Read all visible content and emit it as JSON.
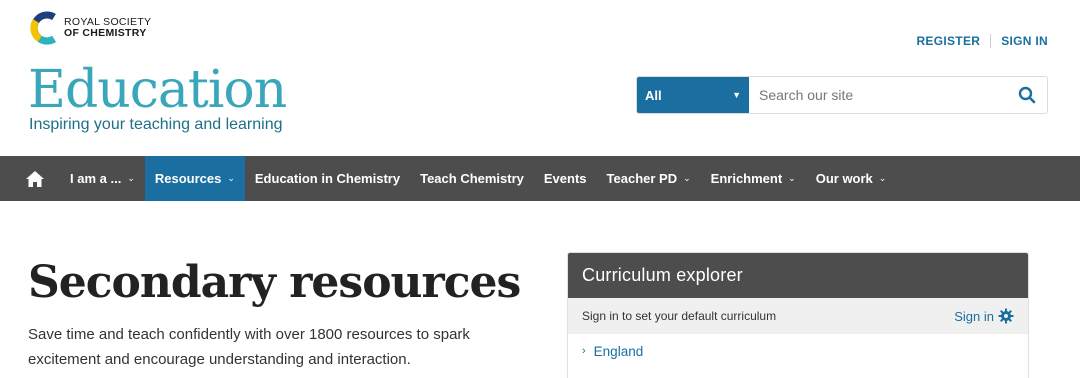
{
  "header": {
    "logo": {
      "line1": "ROYAL SOCIETY",
      "line2": "OF CHEMISTRY"
    },
    "links": {
      "register": "REGISTER",
      "sign_in": "SIGN IN"
    },
    "brand": {
      "title": "Education",
      "tagline": "Inspiring your teaching and learning"
    },
    "search": {
      "scope": "All",
      "placeholder": "Search our site"
    }
  },
  "nav": {
    "items": [
      {
        "label": "I am a ...",
        "has_dropdown": true
      },
      {
        "label": "Resources",
        "has_dropdown": true,
        "active": true
      },
      {
        "label": "Education in Chemistry",
        "has_dropdown": false
      },
      {
        "label": "Teach Chemistry",
        "has_dropdown": false
      },
      {
        "label": "Events",
        "has_dropdown": false
      },
      {
        "label": "Teacher PD",
        "has_dropdown": true
      },
      {
        "label": "Enrichment",
        "has_dropdown": true
      },
      {
        "label": "Our work",
        "has_dropdown": true
      }
    ]
  },
  "main": {
    "title": "Secondary resources",
    "description": "Save time and teach confidently with over 1800 resources to spark excitement and encourage understanding and interaction."
  },
  "curriculum_explorer": {
    "title": "Curriculum explorer",
    "prompt": "Sign in to set your default curriculum",
    "sign_in": "Sign in",
    "items": [
      "England"
    ]
  },
  "colors": {
    "brand_teal": "#3aa6b9",
    "link_blue": "#1a6fa0",
    "nav_dark": "#4d4d4d"
  }
}
